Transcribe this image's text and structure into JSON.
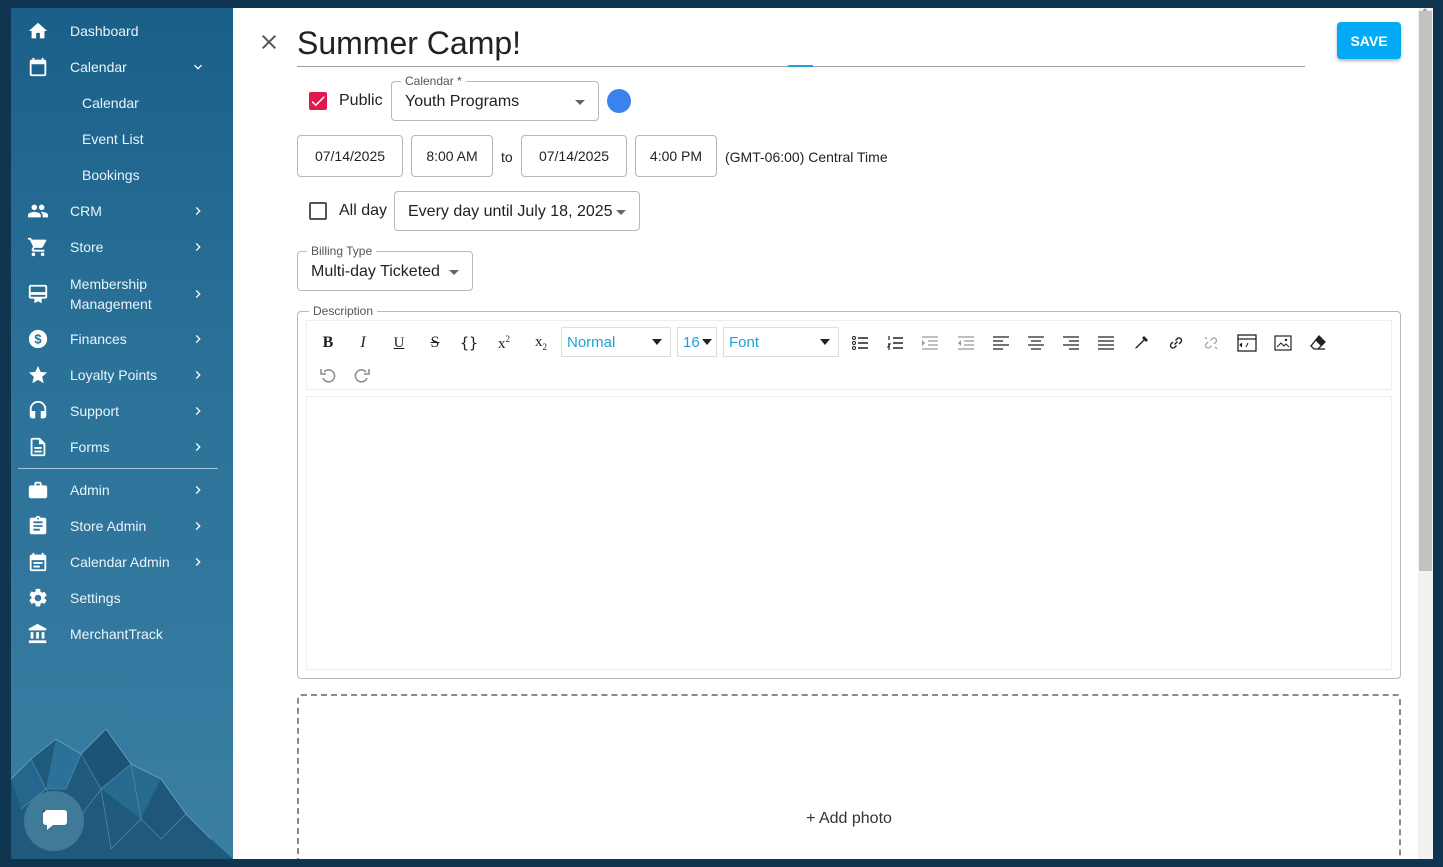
{
  "sidebar": {
    "items": [
      {
        "label": "Dashboard",
        "icon": "home-icon"
      },
      {
        "label": "Calendar",
        "icon": "calendar-icon"
      },
      {
        "label": "CRM",
        "icon": "people-icon"
      },
      {
        "label": "Store",
        "icon": "cart-icon"
      },
      {
        "label": "Membership Management",
        "label_line1": "Membership",
        "label_line2": "Management",
        "icon": "membership-card-icon"
      },
      {
        "label": "Finances",
        "icon": "dollar-icon"
      },
      {
        "label": "Loyalty Points",
        "icon": "star-icon"
      },
      {
        "label": "Support",
        "icon": "headset-icon"
      },
      {
        "label": "Forms",
        "icon": "document-icon"
      },
      {
        "label": "Admin",
        "icon": "briefcase-icon"
      },
      {
        "label": "Store Admin",
        "icon": "clipboard-icon"
      },
      {
        "label": "Calendar Admin",
        "icon": "calendar-admin-icon"
      },
      {
        "label": "Settings",
        "icon": "gear-icon"
      },
      {
        "label": "MerchantTrack",
        "icon": "bank-icon"
      }
    ],
    "calendar_sub": [
      "Calendar",
      "Event List",
      "Bookings"
    ]
  },
  "event": {
    "title": "Summer Camp!",
    "save_label": "SAVE",
    "public_label": "Public",
    "public_checked": true,
    "calendar_legend": "Calendar *",
    "calendar_value": "Youth Programs",
    "calendar_color": "#3b82ee",
    "start_date": "07/14/2025",
    "start_time": "8:00 AM",
    "to_label": "to",
    "end_date": "07/14/2025",
    "end_time": "4:00 PM",
    "timezone": "(GMT-06:00) Central Time",
    "allday_label": "All day",
    "allday_checked": false,
    "recurrence": "Every day until July 18, 2025",
    "billing_legend": "Billing Type",
    "billing_value": "Multi-day Ticketed",
    "description_legend": "Description",
    "add_photo": "+ Add photo"
  },
  "toolbar": {
    "header_value": "Normal",
    "size_value": "16",
    "font_value": "Font"
  },
  "colors": {
    "accent": "#03a9f4",
    "checkbox": "#e0194c",
    "sidebar": "#2a7198"
  }
}
